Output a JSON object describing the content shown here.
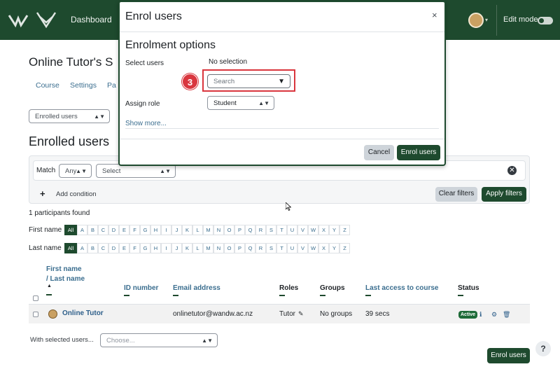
{
  "navbar": {
    "dashboard_label": "Dashboard",
    "edit_mode_label": "Edit mode"
  },
  "page": {
    "course_title": "Online Tutor's S",
    "tabs": [
      "Course",
      "Settings",
      "Pa"
    ],
    "enrolled_select": "Enrolled users",
    "heading": "Enrolled users"
  },
  "filters": {
    "match_label": "Match",
    "match_value": "Any",
    "select_value": "Select",
    "add_condition": "Add condition",
    "clear_filters": "Clear filters",
    "apply_filters": "Apply filters",
    "participants_found": "1 participants found"
  },
  "initials": {
    "first_name_label": "First name",
    "last_name_label": "Last name",
    "letters": [
      "All",
      "A",
      "B",
      "C",
      "D",
      "E",
      "F",
      "G",
      "H",
      "I",
      "J",
      "K",
      "L",
      "M",
      "N",
      "O",
      "P",
      "Q",
      "R",
      "S",
      "T",
      "U",
      "V",
      "W",
      "X",
      "Y",
      "Z"
    ]
  },
  "table": {
    "headers": {
      "first_name": "First name",
      "last_name": "/ Last name",
      "id_number": "ID number",
      "email": "Email address",
      "roles": "Roles",
      "groups": "Groups",
      "last_access": "Last access to course",
      "status": "Status"
    },
    "rows": [
      {
        "name": "Online Tutor",
        "email": "onlinetutor@wandw.ac.nz",
        "role": "Tutor",
        "groups": "No groups",
        "last_access": "39 secs",
        "status": "Active"
      }
    ]
  },
  "bulk": {
    "label": "With selected users...",
    "placeholder": "Choose..."
  },
  "enrol_button": "Enrol users",
  "help_icon_text": "?",
  "modal": {
    "title": "Enrol users",
    "close": "×",
    "section_title": "Enrolment options",
    "select_users_label": "Select users",
    "no_selection": "No selection",
    "search_placeholder": "Search",
    "assign_role_label": "Assign role",
    "role_value": "Student",
    "show_more": "Show more...",
    "cancel": "Cancel",
    "submit": "Enrol users",
    "step_number": "3"
  },
  "colors": {
    "brand_green": "#1e4a2e",
    "highlight_red": "#d9363e",
    "link_blue": "#3b6e8f"
  }
}
